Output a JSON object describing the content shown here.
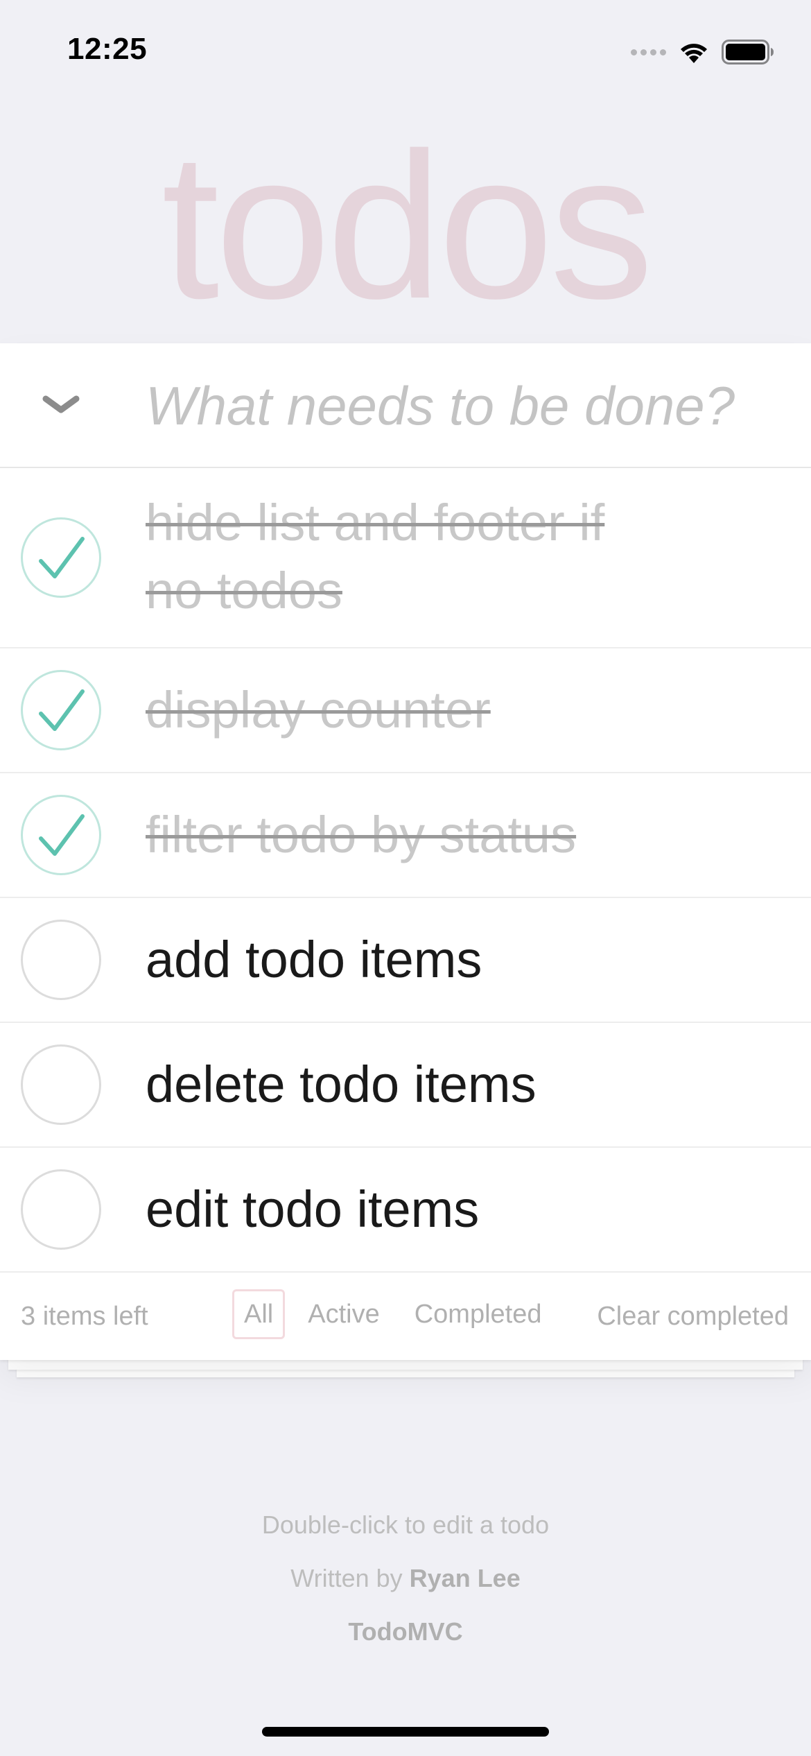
{
  "status_bar": {
    "time": "12:25",
    "icons": [
      "signal-icon",
      "wifi-icon",
      "battery-icon"
    ]
  },
  "header": {
    "title": "todos"
  },
  "new_todo": {
    "placeholder": "What needs to be done?",
    "value": "",
    "toggle_all_icon": "chevron-down-icon"
  },
  "todos": [
    {
      "label": "hide list and footer if no todos",
      "completed": true
    },
    {
      "label": "display counter",
      "completed": true
    },
    {
      "label": "filter todo by status",
      "completed": true
    },
    {
      "label": "add todo items",
      "completed": false
    },
    {
      "label": "delete todo items",
      "completed": false
    },
    {
      "label": "edit todo items",
      "completed": false
    }
  ],
  "footer": {
    "items_left": "3 items left",
    "filters": [
      "All",
      "Active",
      "Completed"
    ],
    "selected_filter": "All",
    "clear_completed": "Clear completed"
  },
  "info": {
    "hint": "Double-click to edit a todo",
    "written_by_prefix": "Written by",
    "author": "Ryan Lee",
    "project": "TodoMVC"
  },
  "colors": {
    "background": "#f0f0f5",
    "title": "#c88c96",
    "check": "#5dc2af",
    "completed_text": "#c8c8c8"
  }
}
